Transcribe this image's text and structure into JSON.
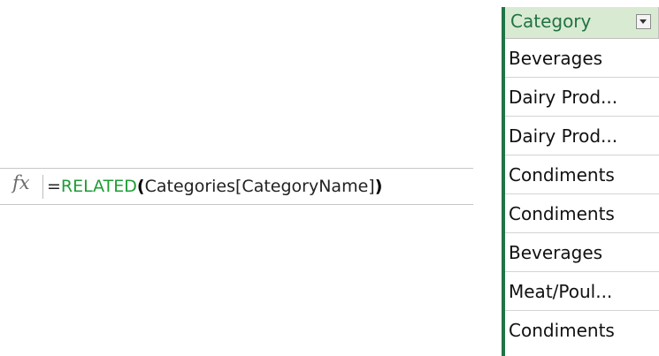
{
  "formula_bar": {
    "fx_icon": "fx-icon",
    "parts": {
      "eq": "=",
      "func": "RELATED",
      "open": "(",
      "args": "Categories[CategoryName]",
      "close": ")"
    }
  },
  "column": {
    "header": "Category",
    "dropdown_icon": "dropdown-arrow-icon",
    "cells": [
      "Beverages",
      "Dairy Prod...",
      "Dairy Prod...",
      "Condiments",
      "Condiments",
      "Beverages",
      "Meat/Poul...",
      "Condiments"
    ]
  },
  "colors": {
    "function": "#1e9d35",
    "selection_border": "#217346",
    "header_fill": "#d9ead3",
    "header_text": "#217346"
  }
}
